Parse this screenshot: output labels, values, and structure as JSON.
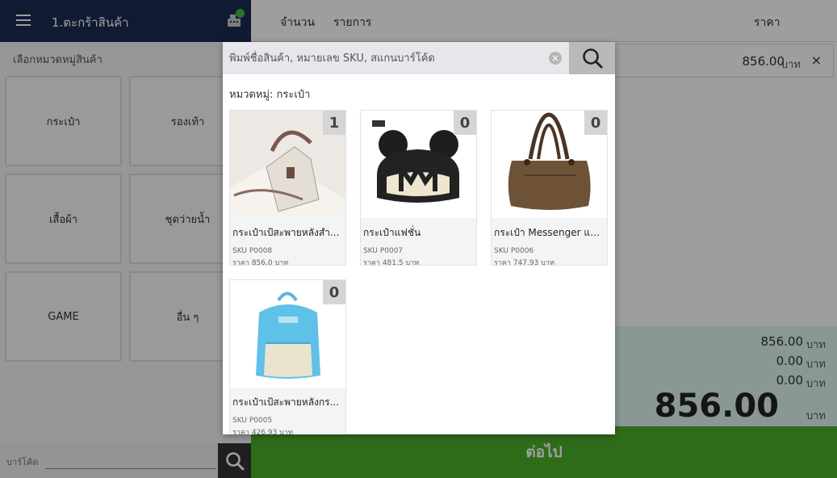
{
  "header": {
    "title": "1.ตะกร้าสินค้า",
    "col_qty": "จำนวน",
    "col_item": "รายการ",
    "col_price": "ราคา"
  },
  "left_panel": {
    "heading": "เลือกหมวดหมู่สินค้า",
    "categories": [
      "กระเป๋า",
      "รองเท้า",
      "เสื้อผ้า",
      "ชุดว่ายน้ำ",
      "GAME",
      "อื่น ๆ"
    ]
  },
  "barcode": {
    "label": "บาร์โค้ด",
    "value": ""
  },
  "cart": {
    "rows": [
      {
        "price": "856.00",
        "unit": "บาท",
        "remove": "×"
      }
    ]
  },
  "summary": {
    "lines": [
      {
        "value": "856.00",
        "unit": "บาท"
      },
      {
        "value": "0.00",
        "unit": "บาท"
      },
      {
        "value": "0.00",
        "unit": "บาท"
      }
    ],
    "total": "856.00",
    "total_unit": "บาท"
  },
  "next_button": "ต่อไป",
  "modal": {
    "search_placeholder": "พิมพ์ชื่อสินค้า, หมายเลข SKU, สแกนบาร์โค้ด",
    "category_label": "หมวดหมู่: กระเป๋า",
    "products": [
      {
        "name": "กระเป๋าเป้สะพายหลังสำ...",
        "sku": "SKU P0008",
        "price": "ราคา 856.0 บาท",
        "count": "1",
        "image": "white-handbag"
      },
      {
        "name": "กระเป๋าแฟชั่น",
        "sku": "SKU P0007",
        "price": "ราคา 481.5 บาท",
        "count": "0",
        "image": "mickey-bag"
      },
      {
        "name": "กระเป๋า Messenger แบ...",
        "sku": "SKU P0006",
        "price": "ราคา 747.93 บาท",
        "count": "0",
        "image": "brown-hobo-bag"
      },
      {
        "name": "กระเป๋าเป้สะพายหลังกร...",
        "sku": "SKU P0005",
        "price": "ราคา 426.93 บาท",
        "count": "0",
        "image": "blue-backpack"
      }
    ]
  },
  "colors": {
    "header_bg": "#1b2a52",
    "next_green": "#4caf2a",
    "summary_bg": "#ddf5f0",
    "status_dot": "#3cbc47"
  }
}
